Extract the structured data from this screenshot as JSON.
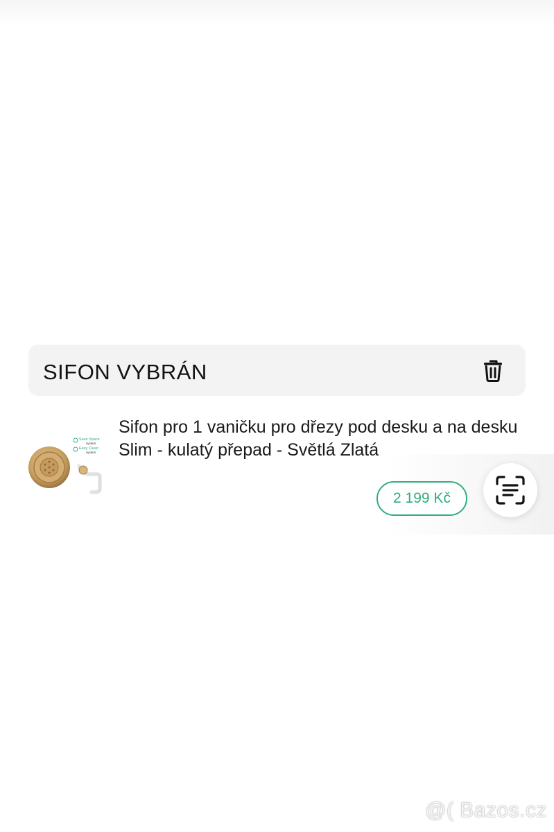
{
  "section": {
    "title": "SIFON VYBRÁN",
    "delete_icon": "trash-icon"
  },
  "product": {
    "title": "Sifon pro 1 vaničku pro dřezy pod desku a na desku Slim - kulatý přepad - Světlá Zlatá",
    "price": "2 199 Kč",
    "thumbnail_labels": [
      "Save Space",
      "system",
      "Easy Clean",
      "system"
    ]
  },
  "actions": {
    "scan_icon": "text-scan-icon"
  },
  "watermark": "@( Bazos.cz",
  "colors": {
    "accent_green": "#2fae7a",
    "header_bg": "#f3f3f3",
    "gold": "#c9a063"
  }
}
